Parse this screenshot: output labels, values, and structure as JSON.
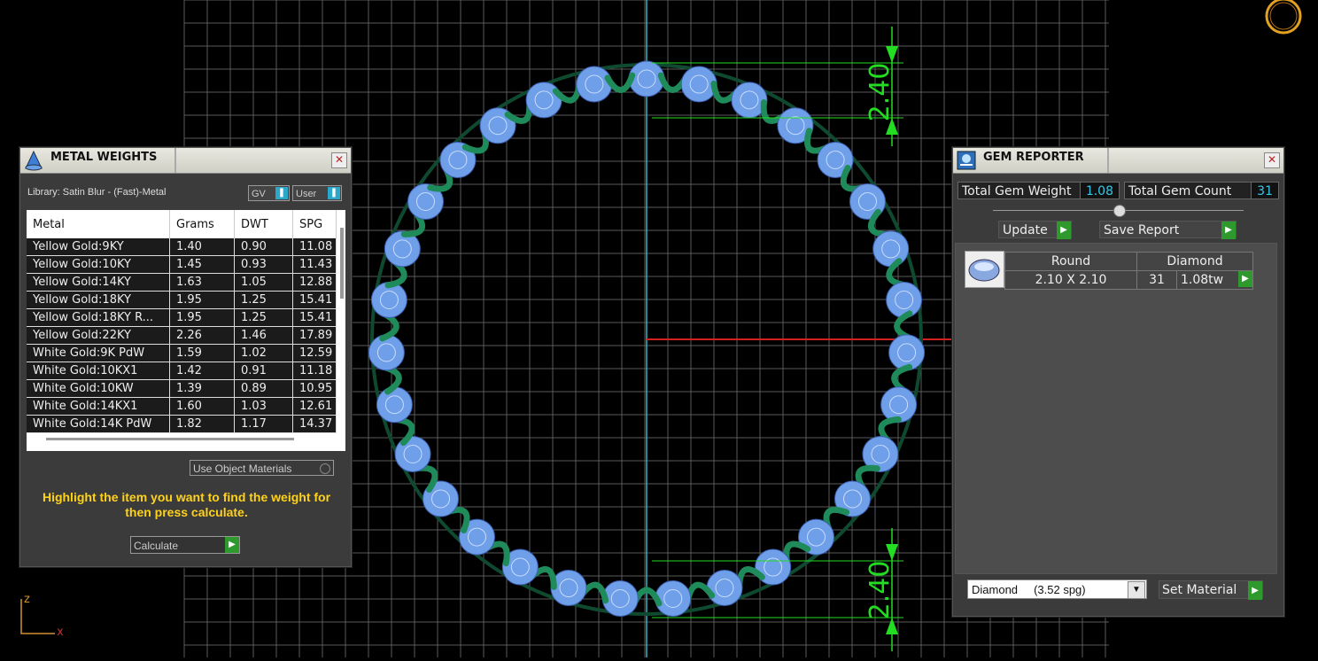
{
  "viewport": {
    "dimension_label": "2.40",
    "axis_z_label": "z",
    "axis_x_label": "x",
    "colors": {
      "grid": "#5a5a5a",
      "axis_y": "#2fb5c5",
      "axis_x": "#d22020",
      "dimension": "#22dd22",
      "metal": "#1f8a5a",
      "gem": "#6f9fe8"
    }
  },
  "metal_weights": {
    "title": "METAL WEIGHTS",
    "library_label": "Library: Satin Blur - (Fast)-Metal",
    "toggle_gv": "GV",
    "toggle_user": "User",
    "columns": [
      "Metal",
      "Grams",
      "DWT",
      "SPG"
    ],
    "rows": [
      [
        "Yellow Gold:9KY",
        "1.40",
        "0.90",
        "11.08"
      ],
      [
        "Yellow Gold:10KY",
        "1.45",
        "0.93",
        "11.43"
      ],
      [
        "Yellow Gold:14KY",
        "1.63",
        "1.05",
        "12.88"
      ],
      [
        "Yellow Gold:18KY",
        "1.95",
        "1.25",
        "15.41"
      ],
      [
        "Yellow Gold:18KY R...",
        "1.95",
        "1.25",
        "15.41"
      ],
      [
        "Yellow Gold:22KY",
        "2.26",
        "1.46",
        "17.89"
      ],
      [
        "White Gold:9K PdW",
        "1.59",
        "1.02",
        "12.59"
      ],
      [
        "White Gold:10KX1",
        "1.42",
        "0.91",
        "11.18"
      ],
      [
        "White Gold:10KW",
        "1.39",
        "0.89",
        "10.95"
      ],
      [
        "White Gold:14KX1",
        "1.60",
        "1.03",
        "12.61"
      ],
      [
        "White Gold:14K PdW",
        "1.82",
        "1.17",
        "14.37"
      ]
    ],
    "use_object_materials": "Use Object Materials",
    "hint": "Highlight the item you want to find the weight for then press calculate.",
    "calculate_label": "Calculate"
  },
  "gem_reporter": {
    "title": "GEM REPORTER",
    "total_weight_label": "Total Gem Weight",
    "total_weight_value": "1.08",
    "total_count_label": "Total Gem Count",
    "total_count_value": "31",
    "update_label": "Update",
    "save_report_label": "Save Report",
    "gem_header": [
      "Round",
      "Diamond"
    ],
    "gem_size": "2.10 X 2.10",
    "gem_count": "31",
    "gem_weight": "1.08tw",
    "material_select": "Diamond     (3.52 spg)",
    "set_material_label": "Set Material"
  }
}
